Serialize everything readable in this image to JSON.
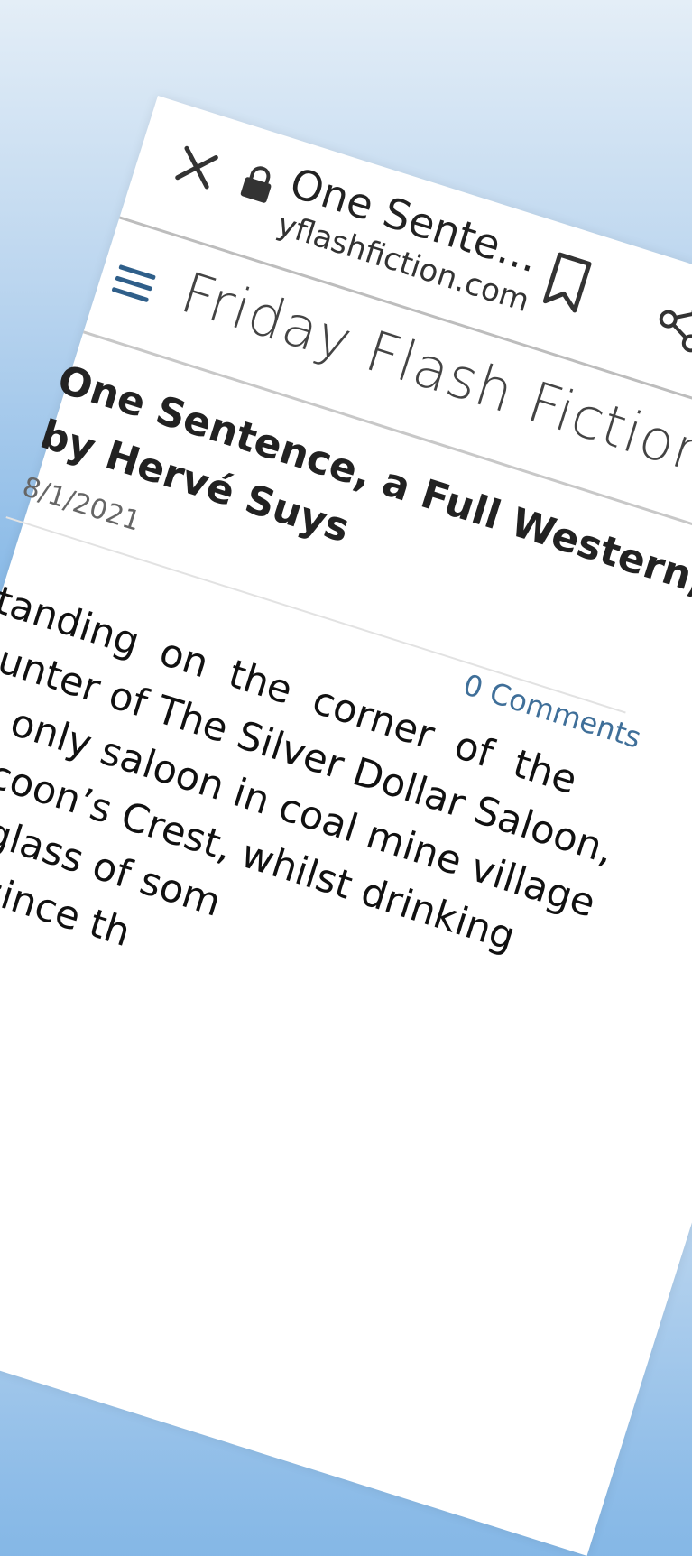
{
  "browser": {
    "tab_title": "One Sente...",
    "url": "yflashfiction.com",
    "close_icon": "close-icon",
    "lock_icon": "lock-icon",
    "bookmark_icon": "bookmark-icon",
    "share_icon": "share-icon"
  },
  "site": {
    "title": "Friday Flash Fiction",
    "menu_icon": "hamburger-menu-icon",
    "accent_color": "#2f5f8a"
  },
  "article": {
    "title_line1": "One Sentence, a Full Western,",
    "title_line2": "by Hervé Suys",
    "date": "8/1/2021",
    "comments": "0 Comments",
    "body_lines": [
      "Standing on the corner of the",
      "counter of The Silver Dollar Saloon,",
      "the only saloon in coal mine village",
      "Raccoon’s Crest, whilst drinking",
      "and glass of som",
      "man since th"
    ]
  }
}
